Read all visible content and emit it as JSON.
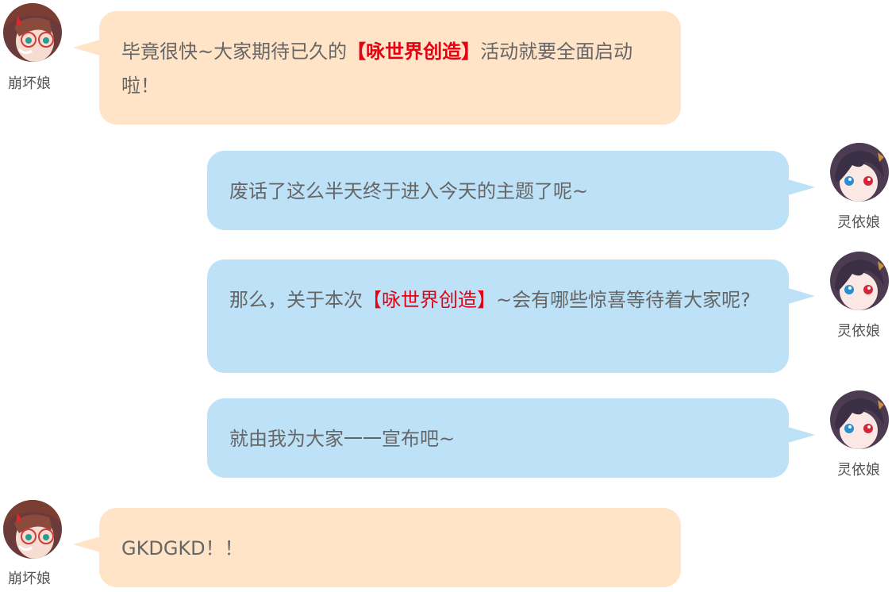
{
  "messages": [
    {
      "side": "left",
      "speaker": "崩坏娘",
      "avatar_icon": "honkai-girl-avatar-icon",
      "parts": [
        {
          "text": "毕竟很快~大家期待已久的"
        },
        {
          "text": "【咏世界创造】",
          "style": "highlight-bold"
        },
        {
          "text": "活动就要全面启动啦！"
        }
      ]
    },
    {
      "side": "right",
      "speaker": "灵依娘",
      "avatar_icon": "lingyi-girl-avatar-icon",
      "parts": [
        {
          "text": "废话了这么半天终于进入今天的主题了呢~"
        }
      ]
    },
    {
      "side": "right",
      "speaker": "灵依娘",
      "avatar_icon": "lingyi-girl-avatar-icon",
      "parts": [
        {
          "text": "那么，关于本次"
        },
        {
          "text": "【咏世界创造】",
          "style": "highlight"
        },
        {
          "text": "~会有哪些惊喜等待着大家呢?"
        }
      ]
    },
    {
      "side": "right",
      "speaker": "灵依娘",
      "avatar_icon": "lingyi-girl-avatar-icon",
      "parts": [
        {
          "text": "就由我为大家一一宣布吧~"
        }
      ]
    },
    {
      "side": "left",
      "speaker": "崩坏娘",
      "avatar_icon": "honkai-girl-avatar-icon",
      "parts": [
        {
          "text": "GKDGKD！！"
        }
      ]
    }
  ],
  "colors": {
    "left_bubble": "#ffe4c8",
    "right_bubble": "#bde1f7",
    "highlight": "#e60012",
    "text": "#666666"
  }
}
